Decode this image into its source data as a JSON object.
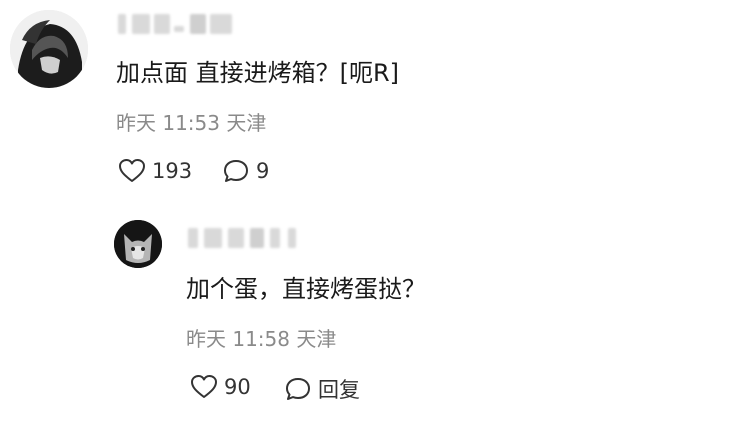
{
  "comments": [
    {
      "text": "加点面 直接进烤箱？[呃R]",
      "time": "昨天 11:53 天津",
      "likes": "193",
      "replies": "9"
    },
    {
      "text": "加个蛋，直接烤蛋挞？",
      "time": "昨天 11:58 天津",
      "likes": "90",
      "reply_label": "回复"
    }
  ],
  "colors": {
    "text": "#1a1a1a",
    "meta": "#8a8a8a",
    "icon": "#333333"
  },
  "icons": {
    "like": "heart-outline-icon",
    "comment": "speech-bubble-icon"
  }
}
